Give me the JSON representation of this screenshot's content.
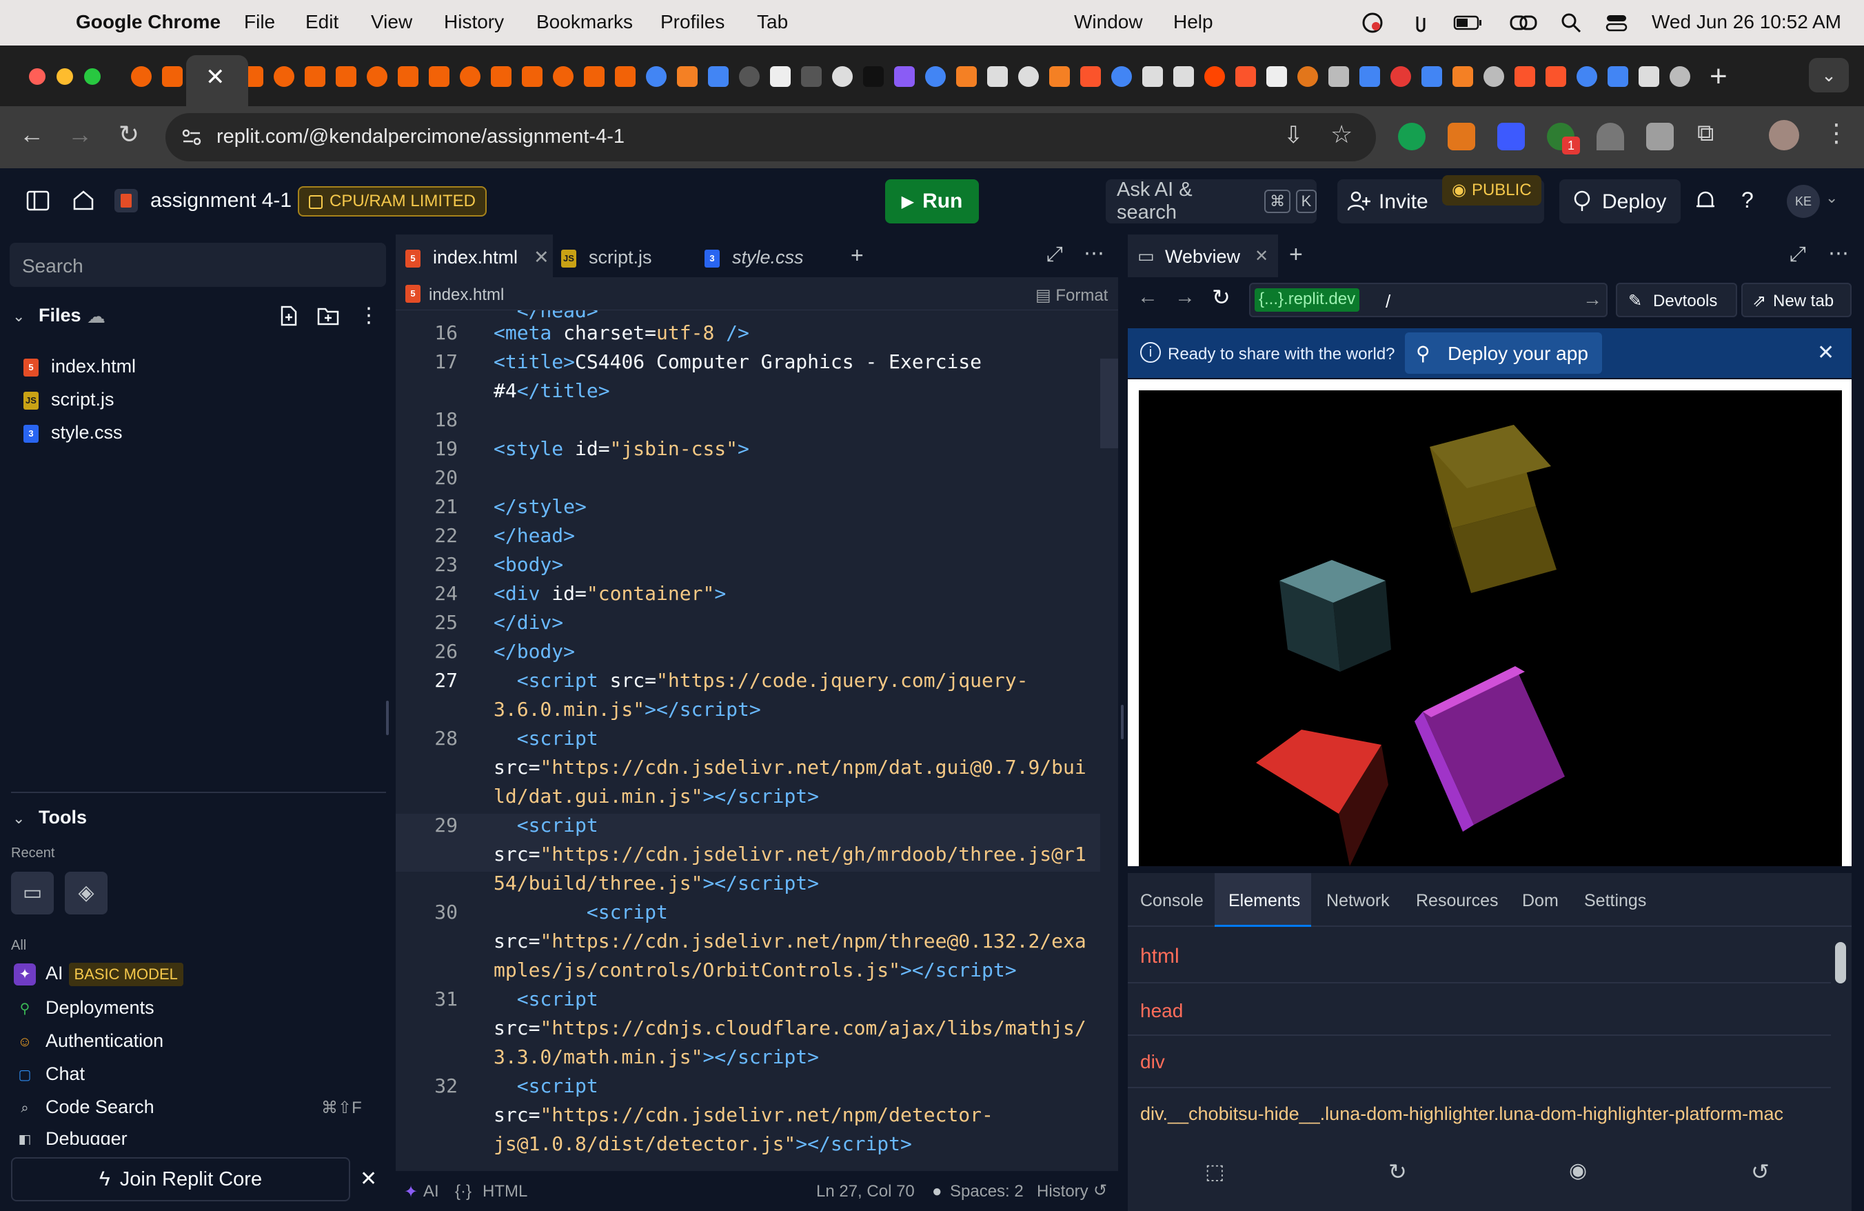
{
  "menubar": {
    "app_name": "Google Chrome",
    "menus": [
      "File",
      "Edit",
      "View",
      "History",
      "Bookmarks",
      "Profiles",
      "Tab",
      "Window",
      "Help"
    ],
    "datetime": "Wed Jun 26  10:52 AM"
  },
  "browser": {
    "url": "replit.com/@kendalpercimone/assignment-4-1",
    "notification_badge": "1"
  },
  "header": {
    "repl_name": "assignment 4-1",
    "limited_label": "CPU/RAM LIMITED",
    "run_label": "Run",
    "ask_ai_label": "Ask AI & search",
    "ask_ai_kbd_cmd": "⌘",
    "ask_ai_kbd_key": "K",
    "invite_label": "Invite",
    "public_label": "PUBLIC",
    "deploy_label": "Deploy",
    "avatar_initials": "KE"
  },
  "sidebar": {
    "search_placeholder": "Search",
    "files_heading": "Files",
    "files": [
      "index.html",
      "script.js",
      "style.css"
    ],
    "tools_heading": "Tools",
    "recent_label": "Recent",
    "all_label": "All",
    "tools": [
      {
        "label": "AI",
        "badge": "BASIC MODEL"
      },
      {
        "label": "Deployments"
      },
      {
        "label": "Authentication"
      },
      {
        "label": "Chat"
      },
      {
        "label": "Code Search",
        "shortcut": "⌘⇧F"
      },
      {
        "label": "Debugger"
      }
    ],
    "join_core_label": "Join Replit Core"
  },
  "editor": {
    "tabs": [
      "index.html",
      "script.js",
      "style.css"
    ],
    "breadcrumb": "index.html",
    "format_label": "Format",
    "status": {
      "ai": "AI",
      "language": "HTML",
      "cursor": "Ln 27, Col 70",
      "spaces": "Spaces: 2",
      "history": "History"
    }
  },
  "webview": {
    "tab_label": "Webview",
    "url_host": "{...}.replit.dev",
    "url_path": "/",
    "devtools_label": "Devtools",
    "new_tab_label": "New tab",
    "banner_text": "Ready to share with the world?",
    "banner_button": "Deploy your app",
    "devtools_tabs": [
      "Console",
      "Elements",
      "Network",
      "Resources",
      "Dom",
      "Settings"
    ],
    "elements": [
      "html",
      "head",
      "div",
      "div.__chobitsu-hide__.luna-dom-highlighter.luna-dom-highlighter-platform-mac"
    ]
  },
  "colors": {
    "bg": "#0e1525",
    "surface": "#1c2333",
    "run_green": "#0b7a2c",
    "badge_yellow": "#f5c84b",
    "tag_blue": "#69b9ff",
    "string_orange": "#f5c884"
  }
}
